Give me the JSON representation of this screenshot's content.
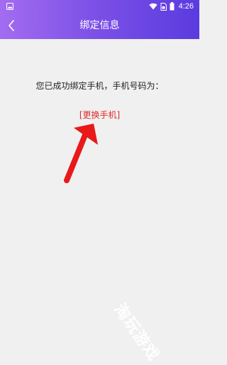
{
  "status_bar": {
    "time": "4:26",
    "icons": [
      "image-icon",
      "wifi-icon",
      "sim-icon",
      "battery-icon"
    ]
  },
  "header": {
    "title": "绑定信息",
    "back_icon": "chevron-left-icon"
  },
  "main": {
    "message": "您已成功绑定手机，手机号码为：",
    "change_phone_link": "[更换手机]"
  },
  "annotations": {
    "arrow_color": "#e81919"
  },
  "watermark": {
    "text": "淘玩游戏"
  },
  "colors": {
    "header_gradient_start": "#a36cf0",
    "header_gradient_end": "#5a3be0",
    "background": "#f0f0f0",
    "link": "#e02a2a"
  }
}
